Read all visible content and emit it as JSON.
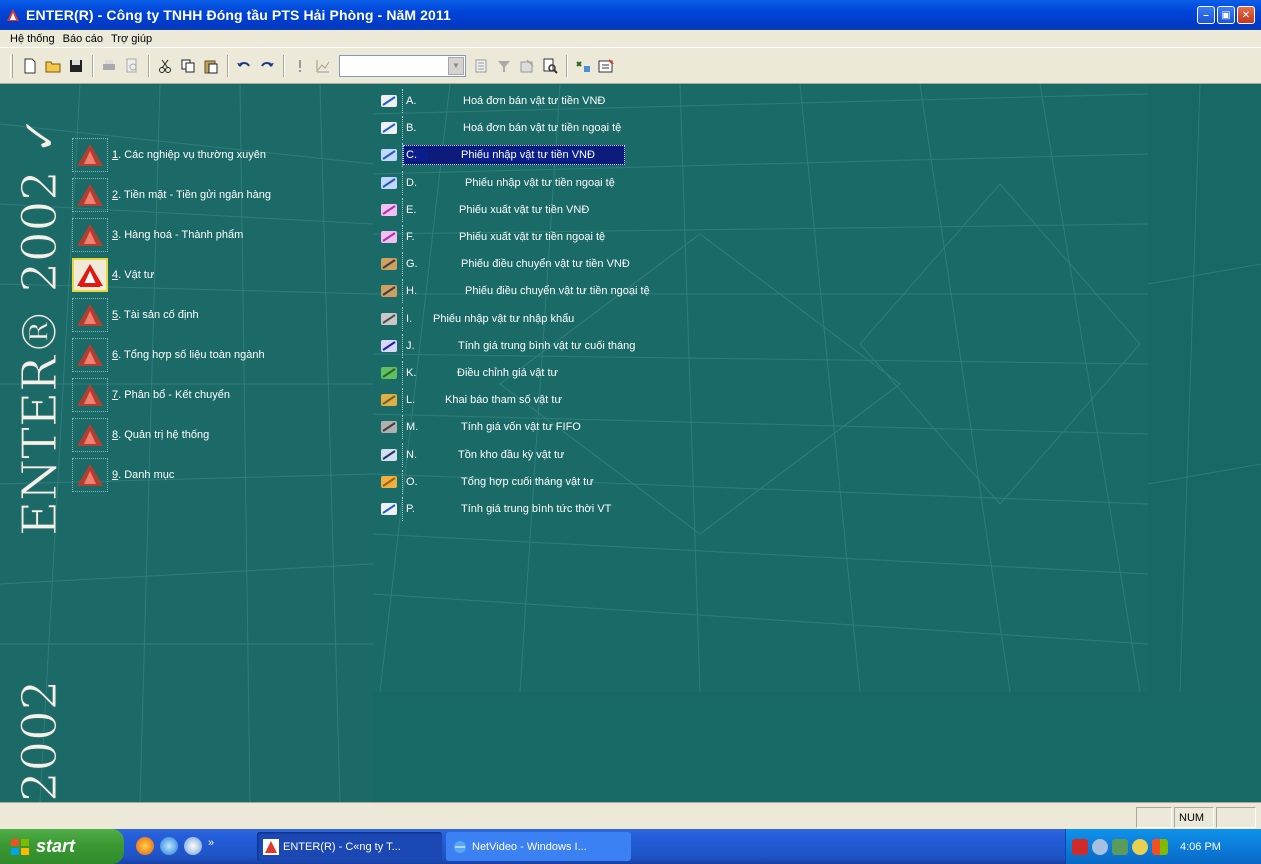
{
  "window": {
    "title": "ENTER(R) - Công ty TNHH Đóng tầu PTS Hải Phòng - NăM 2011"
  },
  "menu": [
    "Hệ thống",
    "Báo cáo",
    "Trợ giúp"
  ],
  "brand": {
    "big": "ENTER® 2002 ✓",
    "small": "2002 ✓"
  },
  "modules": [
    {
      "num": "1",
      "label": ". Các nghiệp vụ thường xuyên"
    },
    {
      "num": "2",
      "label": ". Tiền mặt - Tiền gửi ngân hàng"
    },
    {
      "num": "3",
      "label": ". Hàng hoá - Thành phẩm"
    },
    {
      "num": "4",
      "label": ". Vật tư"
    },
    {
      "num": "5",
      "label": ". Tài sản cố định"
    },
    {
      "num": "6",
      "label": ". Tổng hợp số liệu toàn ngành"
    },
    {
      "num": "7",
      "label": ". Phân bổ - Kết chuyển"
    },
    {
      "num": "8",
      "label": ". Quản trị hệ thống"
    },
    {
      "num": "9",
      "label": ". Danh mục"
    }
  ],
  "submenu": [
    {
      "letter": "A.",
      "text": "Hoá đơn bán vật tư tiền VNĐ",
      "icon": "pen-icon"
    },
    {
      "letter": "B.",
      "text": "Hoá đơn bán vật tư tiền ngoại tệ",
      "icon": "pen-icon"
    },
    {
      "letter": "C.",
      "text": "Phiếu nhập vật tư tiền VNĐ",
      "icon": "import-icon"
    },
    {
      "letter": "D.",
      "text": "Phiếu nhập vật tư tiền ngoại tệ",
      "icon": "import-icon"
    },
    {
      "letter": "E.",
      "text": "Phiếu xuất vật tư tiền VNĐ",
      "icon": "export-icon"
    },
    {
      "letter": "F.",
      "text": "Phiếu xuất vật tư tiền ngoại tệ",
      "icon": "export-icon"
    },
    {
      "letter": "G.",
      "text": "Phiếu điều chuyển vật tư tiền VNĐ",
      "icon": "transfer-icon"
    },
    {
      "letter": "H.",
      "text": "Phiếu điều chuyển vật tư tiền ngoại tệ",
      "icon": "transfer-icon"
    },
    {
      "letter": "I.",
      "text": "Phiếu nhập vật tư nhập khẩu",
      "icon": "truck-icon"
    },
    {
      "letter": "J.",
      "text": "Tính giá trung bình vật tư cuối tháng",
      "icon": "calc-icon"
    },
    {
      "letter": "K.",
      "text": "Điều chỉnh giá vật tư",
      "icon": "adjust-icon"
    },
    {
      "letter": "L.",
      "text": "Khai báo tham số vật tư",
      "icon": "params-icon"
    },
    {
      "letter": "M.",
      "text": "Tính giá vốn vật tư FIFO",
      "icon": "fifo-icon"
    },
    {
      "letter": "N.",
      "text": "Tồn kho đầu kỳ vật tư",
      "icon": "inventory-icon"
    },
    {
      "letter": "O.",
      "text": "Tổng hợp cuối tháng vật tư",
      "icon": "folder-icon"
    },
    {
      "letter": "P.",
      "text": "Tính giá trung bình tức thời VT",
      "icon": "pen-icon"
    }
  ],
  "statusbar": {
    "num": "NUM"
  },
  "taskbar": {
    "start": "start",
    "tasks": [
      "ENTER(R) - C«ng ty T...",
      "NetVideo - Windows I..."
    ],
    "clock": "4:06 PM"
  },
  "colors": {
    "background": "#1a6c69",
    "selected": "#0d1c7a",
    "titlebar": "#0045d8"
  }
}
